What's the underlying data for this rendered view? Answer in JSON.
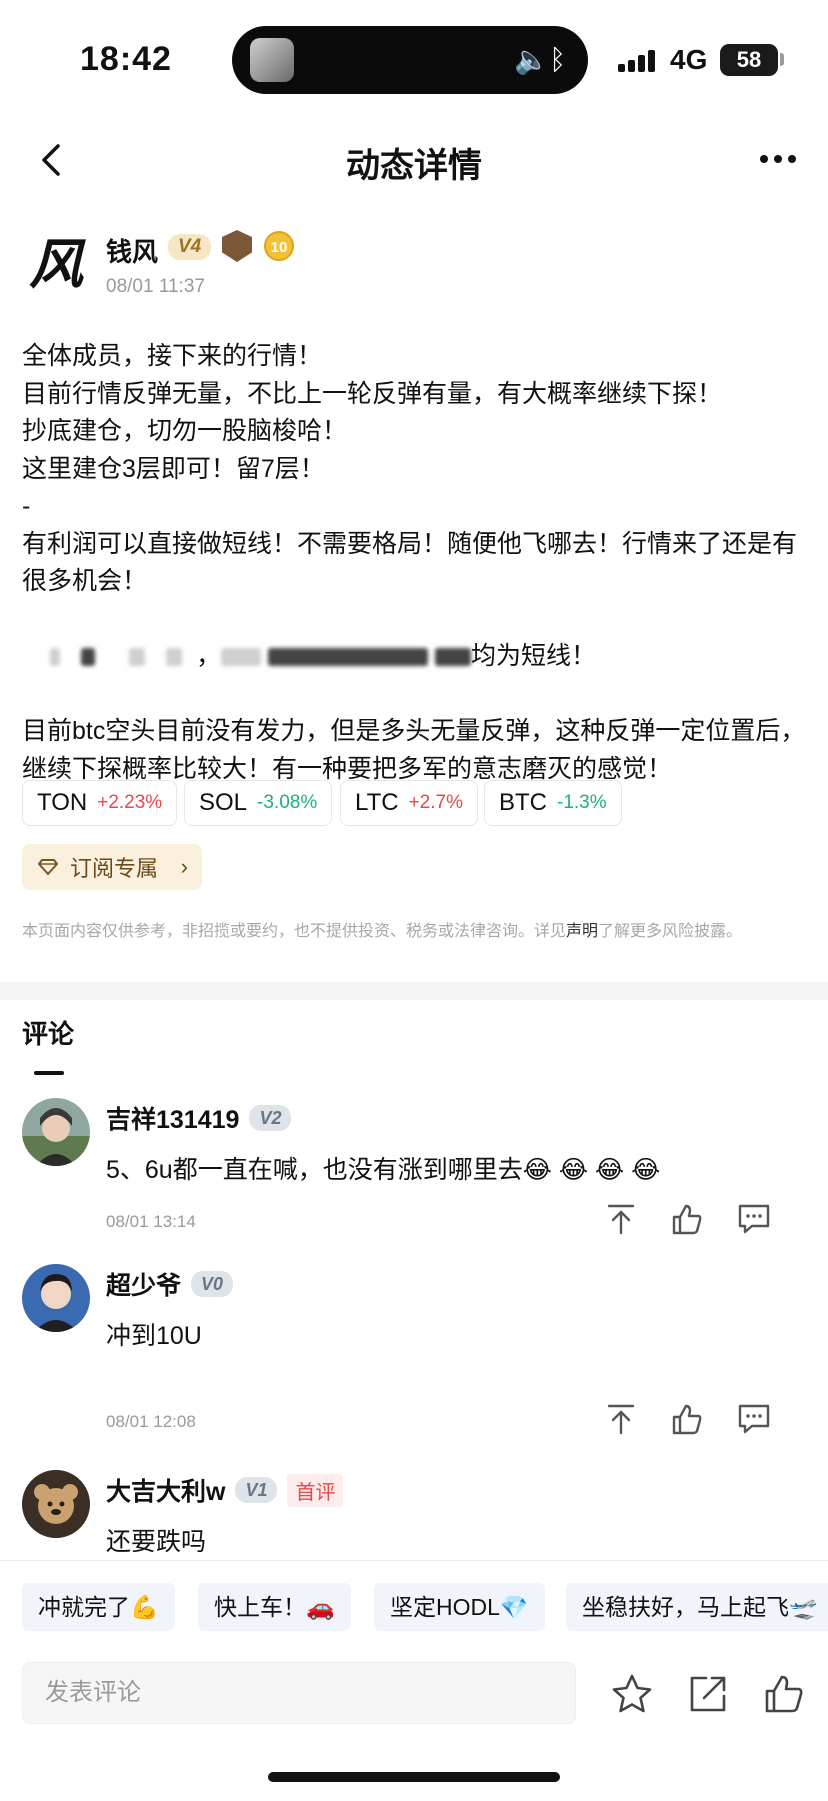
{
  "status_bar": {
    "time": "18:42",
    "network": "4G",
    "battery": "58"
  },
  "nav": {
    "title": "动态详情"
  },
  "author": {
    "name": "钱风",
    "level_badge": "V4",
    "rank_number": "10",
    "timestamp": "08/01 11:37",
    "logo_char": "风"
  },
  "post": {
    "lines": [
      "全体成员，接下来的行情！",
      "目前行情反弹无量，不比上一轮反弹有量，有大概率继续下探！",
      "抄底建仓，切勿一股脑梭哈！",
      "这里建仓3层即可！留7层！",
      "-",
      "有利润可以直接做短线！不需要格局！随便他飞哪去！行情来了还是有很多机会！"
    ],
    "obscured_line_tail": "均为短线！",
    "lines_after": [
      "目前btc空头目前没有发力，但是多头无量反弹，这种反弹一定位置后，继续下探概率比较大！有一种要把多军的意志磨灭的感觉！"
    ]
  },
  "tickers": [
    {
      "symbol": "TON",
      "change": "+2.23%",
      "direction": "up"
    },
    {
      "symbol": "SOL",
      "change": "-3.08%",
      "direction": "down"
    },
    {
      "symbol": "LTC",
      "change": "+2.7%",
      "direction": "up"
    },
    {
      "symbol": "BTC",
      "change": "-1.3%",
      "direction": "down"
    }
  ],
  "subscribe": {
    "label": "订阅专属"
  },
  "disclaimer": {
    "before": "本页面内容仅供参考，非招揽或要约，也不提供投资、税务或法律咨询。详见",
    "link": "声明",
    "after": "了解更多风险披露。"
  },
  "comments_section": {
    "title": "评论"
  },
  "comments": [
    {
      "user": "吉祥131419",
      "badge": "V2",
      "text": "5、6u都一直在喊，也没有涨到哪里去😂 😂 😂 😂",
      "time": "08/01 13:14"
    },
    {
      "user": "超少爷",
      "badge": "V0",
      "text": "冲到10U",
      "time": "08/01 12:08"
    },
    {
      "user": "大吉大利w",
      "badge": "V1",
      "tag": "首评",
      "text": "还要跌吗"
    }
  ],
  "quick_replies": [
    "冲就完了💪",
    "快上车！🚗",
    "坚定HODL💎",
    "坐稳扶好，马上起飞🛫"
  ],
  "input": {
    "placeholder": "发表评论"
  },
  "colors": {
    "up": "#e5484d",
    "down": "#1fae7e",
    "gold_badge_bg": "#f6e6c4",
    "subscribe_bg": "#fbf0dd"
  }
}
